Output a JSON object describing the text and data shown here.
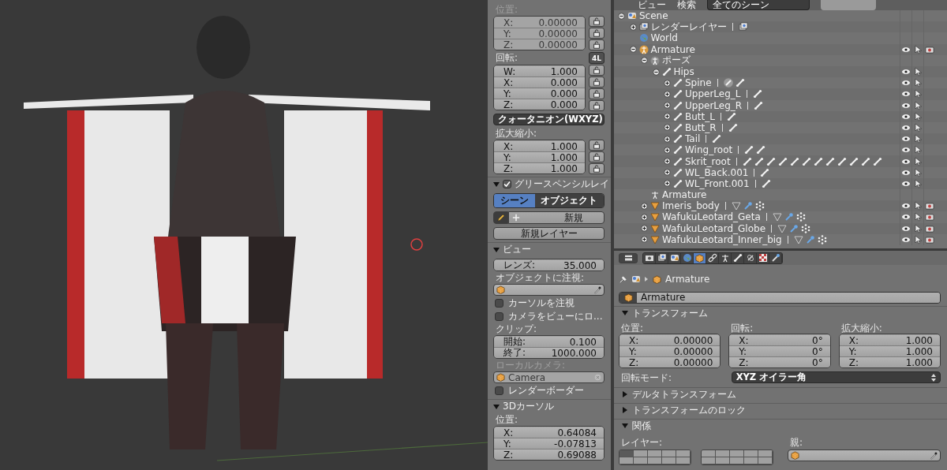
{
  "npanel": {
    "location": {
      "label": "位置:",
      "disabled": true,
      "rows": [
        {
          "axis": "X:",
          "value": "0.00000"
        },
        {
          "axis": "Y:",
          "value": "0.00000"
        },
        {
          "axis": "Z:",
          "value": "0.00000"
        }
      ]
    },
    "rotation": {
      "label": "回転:",
      "lock_mode": "4L",
      "rows": [
        {
          "axis": "W:",
          "value": "1.000"
        },
        {
          "axis": "X:",
          "value": "0.000"
        },
        {
          "axis": "Y:",
          "value": "0.000"
        },
        {
          "axis": "Z:",
          "value": "0.000"
        }
      ],
      "mode": "クォータニオン(WXYZ)"
    },
    "scale": {
      "label": "拡大縮小:",
      "rows": [
        {
          "axis": "X:",
          "value": "1.000"
        },
        {
          "axis": "Y:",
          "value": "1.000"
        },
        {
          "axis": "Z:",
          "value": "1.000"
        }
      ]
    },
    "grease_pencil": {
      "title": "グリースペンシルレイ",
      "expanded": true,
      "checked": true,
      "tabs": [
        {
          "label": "シーン",
          "selected": true
        },
        {
          "label": "オブジェクト",
          "selected": false
        }
      ],
      "new": "新規",
      "new_layer": "新規レイヤー"
    },
    "view": {
      "title": "ビュー",
      "expanded": true,
      "lens": {
        "axis": "レンズ:",
        "value": "35.000"
      },
      "lock_object_label": "オブジェクトに注視:",
      "options": [
        {
          "label": "カーソルを注視",
          "checked": false
        },
        {
          "label": "カメラをビューにロ...",
          "checked": false
        }
      ],
      "clip_label": "クリップ:",
      "clip": [
        {
          "axis": "開始:",
          "value": "0.100"
        },
        {
          "axis": "終了:",
          "value": "1000.000"
        }
      ],
      "local_camera": {
        "label": "ローカルカメラ:",
        "value": "Camera",
        "disabled": true
      },
      "render_border": {
        "label": "レンダーボーダー",
        "checked": false
      }
    },
    "cursor": {
      "title": "3Dカーソル",
      "expanded": true,
      "label": "位置:",
      "rows": [
        {
          "axis": "X:",
          "value": "0.64084"
        },
        {
          "axis": "Y:",
          "value": "-0.07813"
        },
        {
          "axis": "Z:",
          "value": "0.69088"
        }
      ]
    }
  },
  "outliner": {
    "header": {
      "menus": [
        "ビュー",
        "検索"
      ],
      "filter": "全てのシーン"
    },
    "tree": [
      {
        "label": "Scene",
        "kind": "scene",
        "expanded": true,
        "children": [
          {
            "label": "レンダーレイヤー",
            "kind": "render-layer",
            "expanded": false,
            "extras": [
              {
                "kind": "render-layer"
              }
            ]
          },
          {
            "label": "World",
            "kind": "world"
          },
          {
            "label": "Armature",
            "kind": "armature",
            "expanded": true,
            "restrict": [
              {
                "kind": "eye"
              },
              {
                "kind": "select"
              },
              {
                "kind": "render"
              }
            ],
            "children": [
              {
                "label": "ポーズ",
                "kind": "pose",
                "expanded": true,
                "children": [
                  {
                    "label": "Hips",
                    "kind": "bone",
                    "expanded": true,
                    "restrict": [
                      {
                        "kind": "eye"
                      },
                      {
                        "kind": "select"
                      }
                    ],
                    "children": [
                      {
                        "label": "Spine",
                        "kind": "bone",
                        "expanded": false,
                        "extras": [
                          {
                            "kind": "bone-active"
                          },
                          {
                            "kind": "bone"
                          }
                        ],
                        "restrict": [
                          {
                            "kind": "eye"
                          },
                          {
                            "kind": "select"
                          }
                        ]
                      },
                      {
                        "label": "UpperLeg_L",
                        "kind": "bone",
                        "expanded": false,
                        "extras": [
                          {
                            "kind": "bone"
                          }
                        ],
                        "restrict": [
                          {
                            "kind": "eye"
                          },
                          {
                            "kind": "select"
                          }
                        ]
                      },
                      {
                        "label": "UpperLeg_R",
                        "kind": "bone",
                        "expanded": false,
                        "extras": [
                          {
                            "kind": "bone"
                          }
                        ],
                        "restrict": [
                          {
                            "kind": "eye"
                          },
                          {
                            "kind": "select"
                          }
                        ]
                      },
                      {
                        "label": "Butt_L",
                        "kind": "bone",
                        "expanded": false,
                        "extras": [
                          {
                            "kind": "bone"
                          }
                        ],
                        "restrict": [
                          {
                            "kind": "eye"
                          },
                          {
                            "kind": "select"
                          }
                        ]
                      },
                      {
                        "label": "Butt_R",
                        "kind": "bone",
                        "expanded": false,
                        "extras": [
                          {
                            "kind": "bone"
                          }
                        ],
                        "restrict": [
                          {
                            "kind": "eye"
                          },
                          {
                            "kind": "select"
                          }
                        ]
                      },
                      {
                        "label": "Tail",
                        "kind": "bone",
                        "expanded": false,
                        "extras": [
                          {
                            "kind": "bone"
                          }
                        ],
                        "restrict": [
                          {
                            "kind": "eye"
                          },
                          {
                            "kind": "select"
                          }
                        ]
                      },
                      {
                        "label": "Wing_root",
                        "kind": "bone",
                        "expanded": false,
                        "extras": [
                          {
                            "kind": "bone"
                          },
                          {
                            "kind": "bone"
                          }
                        ],
                        "restrict": [
                          {
                            "kind": "eye"
                          },
                          {
                            "kind": "select"
                          }
                        ]
                      },
                      {
                        "label": "Skrit_root",
                        "kind": "bone",
                        "expanded": false,
                        "extras": [
                          {
                            "kind": "bone"
                          },
                          {
                            "kind": "bone"
                          },
                          {
                            "kind": "bone"
                          },
                          {
                            "kind": "bone"
                          },
                          {
                            "kind": "bone"
                          },
                          {
                            "kind": "bone"
                          },
                          {
                            "kind": "bone"
                          },
                          {
                            "kind": "bone"
                          },
                          {
                            "kind": "bone"
                          },
                          {
                            "kind": "bone"
                          },
                          {
                            "kind": "bone"
                          },
                          {
                            "kind": "bone"
                          }
                        ],
                        "restrict": [
                          {
                            "kind": "eye"
                          },
                          {
                            "kind": "select"
                          }
                        ]
                      },
                      {
                        "label": "WL_Back.001",
                        "kind": "bone",
                        "expanded": false,
                        "extras": [
                          {
                            "kind": "bone"
                          }
                        ],
                        "restrict": [
                          {
                            "kind": "eye"
                          },
                          {
                            "kind": "select"
                          }
                        ]
                      },
                      {
                        "label": "WL_Front.001",
                        "kind": "bone",
                        "expanded": false,
                        "extras": [
                          {
                            "kind": "bone"
                          }
                        ],
                        "restrict": [
                          {
                            "kind": "eye"
                          },
                          {
                            "kind": "select"
                          }
                        ]
                      }
                    ]
                  }
                ]
              },
              {
                "label": "Armature",
                "kind": "armature-data"
              },
              {
                "label": "Imeris_body",
                "kind": "mesh",
                "expanded": false,
                "extras": [
                  {
                    "kind": "mesh-data"
                  },
                  {
                    "kind": "wrench"
                  },
                  {
                    "kind": "particles"
                  }
                ],
                "restrict": [
                  {
                    "kind": "eye"
                  },
                  {
                    "kind": "select"
                  },
                  {
                    "kind": "render"
                  }
                ]
              },
              {
                "label": "WafukuLeotard_Geta",
                "kind": "mesh",
                "expanded": false,
                "extras": [
                  {
                    "kind": "mesh-data"
                  },
                  {
                    "kind": "wrench"
                  },
                  {
                    "kind": "particles"
                  }
                ],
                "restrict": [
                  {
                    "kind": "eye"
                  },
                  {
                    "kind": "select"
                  },
                  {
                    "kind": "render"
                  }
                ]
              },
              {
                "label": "WafukuLeotard_Globe",
                "kind": "mesh",
                "expanded": false,
                "extras": [
                  {
                    "kind": "mesh-data"
                  },
                  {
                    "kind": "wrench"
                  },
                  {
                    "kind": "particles"
                  }
                ],
                "restrict": [
                  {
                    "kind": "eye"
                  },
                  {
                    "kind": "select"
                  },
                  {
                    "kind": "render"
                  }
                ]
              },
              {
                "label": "WafukuLeotard_Inner_big",
                "kind": "mesh",
                "expanded": false,
                "extras": [
                  {
                    "kind": "mesh-data"
                  },
                  {
                    "kind": "wrench"
                  },
                  {
                    "kind": "particles"
                  }
                ],
                "restrict": [
                  {
                    "kind": "eye"
                  },
                  {
                    "kind": "select"
                  },
                  {
                    "kind": "render"
                  }
                ]
              }
            ]
          }
        ]
      }
    ]
  },
  "properties": {
    "tabs": [
      {
        "kind": "render",
        "selected": false
      },
      {
        "kind": "layers",
        "selected": false
      },
      {
        "kind": "scene",
        "selected": false
      },
      {
        "kind": "world",
        "selected": false
      },
      {
        "kind": "object",
        "selected": true
      },
      {
        "kind": "constraint",
        "selected": false
      },
      {
        "kind": "armature",
        "selected": false
      },
      {
        "kind": "bone",
        "selected": false
      },
      {
        "kind": "bone-constraint",
        "selected": false
      },
      {
        "kind": "texture",
        "selected": false
      },
      {
        "kind": "brush",
        "selected": false
      }
    ],
    "breadcrumb": "Armature",
    "name": "Armature",
    "transform": {
      "title": "トランスフォーム",
      "expanded": true,
      "columns": [
        {
          "label": "位置:",
          "rows": [
            {
              "axis": "X:",
              "value": "0.00000"
            },
            {
              "axis": "Y:",
              "value": "0.00000"
            },
            {
              "axis": "Z:",
              "value": "0.00000"
            }
          ]
        },
        {
          "label": "回転:",
          "rows": [
            {
              "axis": "X:",
              "value": "0°"
            },
            {
              "axis": "Y:",
              "value": "0°"
            },
            {
              "axis": "Z:",
              "value": "0°"
            }
          ]
        },
        {
          "label": "拡大縮小:",
          "rows": [
            {
              "axis": "X:",
              "value": "1.000"
            },
            {
              "axis": "Y:",
              "value": "1.000"
            },
            {
              "axis": "Z:",
              "value": "1.000"
            }
          ]
        }
      ],
      "mode_label": "回転モード:",
      "mode": "XYZ オイラー角"
    },
    "closed_panels": [
      {
        "title": "デルタトランスフォーム",
        "expanded": false
      },
      {
        "title": "トランスフォームのロック",
        "expanded": false
      }
    ],
    "relations": {
      "title": "関係",
      "expanded": true,
      "layers_label": "レイヤー:",
      "parent_label": "親:",
      "layers": [
        {
          "selected": true
        },
        {
          "selected": false
        },
        {
          "selected": false
        },
        {
          "selected": false
        },
        {
          "selected": false
        },
        {
          "selected": false
        },
        {
          "selected": false
        },
        {
          "selected": false
        },
        {
          "selected": false
        },
        {
          "selected": false
        },
        {
          "selected": false
        },
        {
          "selected": false
        },
        {
          "selected": false
        },
        {
          "selected": false
        },
        {
          "selected": false
        },
        {
          "selected": false
        },
        {
          "selected": false
        },
        {
          "selected": false
        },
        {
          "selected": false
        },
        {
          "selected": false
        }
      ]
    }
  }
}
